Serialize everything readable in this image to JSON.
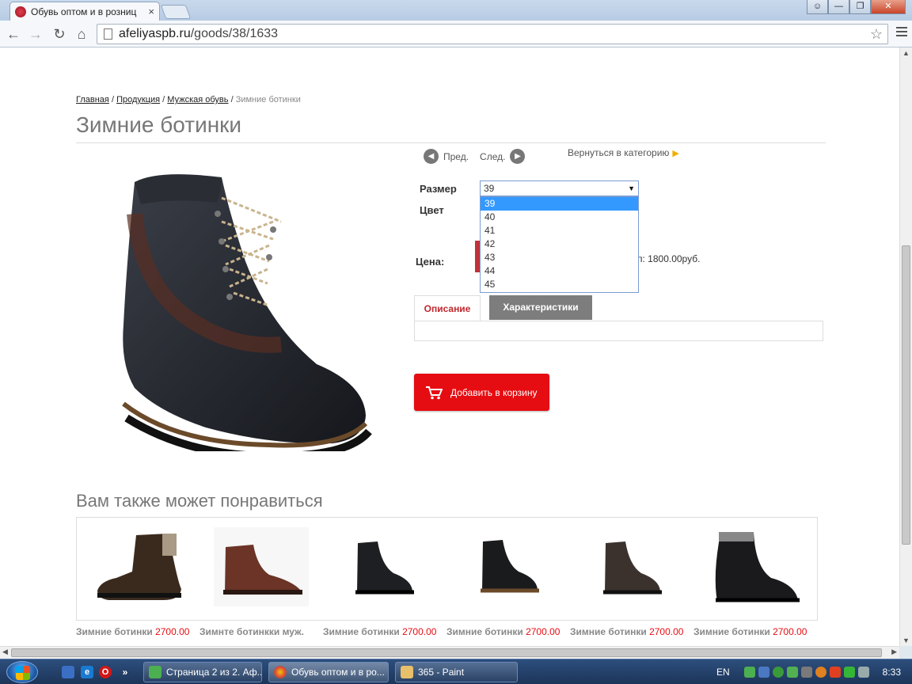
{
  "browser": {
    "tab_title": "Обувь оптом и в розниц",
    "tab_close": "×",
    "url_host": "afeliyaspb.ru",
    "url_path": "/goods/38/1633",
    "window_buttons": [
      "user",
      "minimize",
      "restore",
      "close"
    ]
  },
  "breadcrumb": {
    "items": [
      "Главная",
      "Продукция",
      "Мужская обувь"
    ],
    "separator": "/",
    "current": "Зимние ботинки"
  },
  "product": {
    "title": "Зимние ботинки",
    "prev_label": "Пред.",
    "next_label": "След.",
    "back_label": "Вернуться в категорию",
    "size_label": "Размер",
    "color_label": "Цвет",
    "price_label": "Цена:",
    "price_old_text": "п: 1800.00руб.",
    "size_selected": "39",
    "size_options": [
      "39",
      "40",
      "41",
      "42",
      "43",
      "44",
      "45"
    ],
    "tabs": [
      "Описание",
      "Характеристики"
    ],
    "add_to_cart": "Добавить в корзину"
  },
  "also": {
    "title": "Вам также может понравиться",
    "items": [
      {
        "name": "Зимние ботинки",
        "price": "2700.00"
      },
      {
        "name": "Зимнте ботинкки муж.",
        "price": ""
      },
      {
        "name": "Зимние ботинки",
        "price": "2700.00"
      },
      {
        "name": "Зимние ботинки",
        "price": "2700.00"
      },
      {
        "name": "Зимние ботинки",
        "price": "2700.00"
      },
      {
        "name": "Зимние ботинки",
        "price": "2700.00"
      }
    ]
  },
  "taskbar": {
    "tasks": [
      "Страница 2 из 2. Аф...",
      "Обувь оптом и в ро...",
      "365 - Paint"
    ],
    "lang": "EN",
    "clock": "8:33"
  },
  "colors": {
    "accent_red": "#e60d12",
    "tab_active_text": "#c0282e",
    "dropdown_highlight": "#3399ff"
  }
}
